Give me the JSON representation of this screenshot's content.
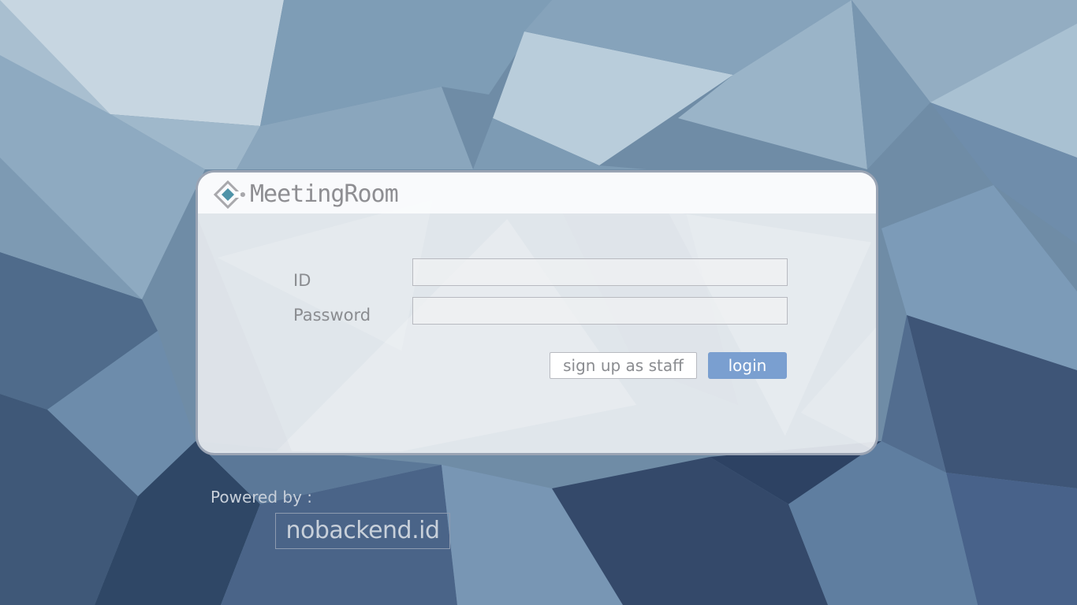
{
  "app": {
    "title": "MeetingRoom"
  },
  "form": {
    "id_label": "ID",
    "id_value": "",
    "password_label": "Password",
    "password_value": ""
  },
  "buttons": {
    "signup_label": "sign up as staff",
    "login_label": "login"
  },
  "footer": {
    "powered_by": "Powered by :",
    "backend_link": "nobackend.id"
  },
  "colors": {
    "login_button": "#7a9fd0",
    "card_border": "#9aa4b4",
    "logo_accent": "#4f93a8",
    "label_text": "#8a8c90"
  },
  "icons": {
    "logo": "meetingroom-logo-icon"
  }
}
